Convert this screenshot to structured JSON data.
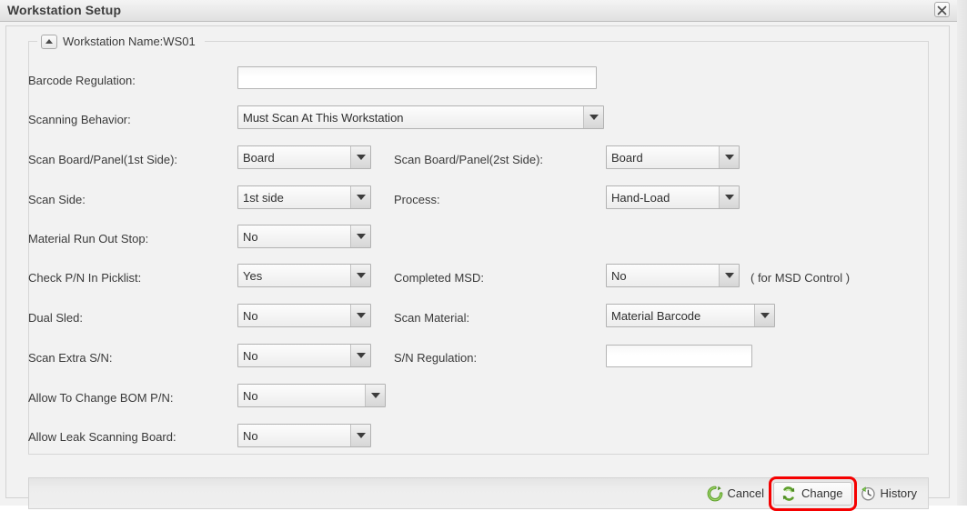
{
  "window": {
    "title": "Workstation Setup",
    "close_icon": "close-icon"
  },
  "group": {
    "legend": "Workstation Name:WS01",
    "collapse_icon": "collapse-up-icon"
  },
  "fields": {
    "barcode_regulation": {
      "label": "Barcode Regulation:",
      "value": "",
      "placeholder": ""
    },
    "scanning_behavior": {
      "label": "Scanning Behavior:",
      "value": "Must Scan At This Workstation"
    },
    "scan_board_panel_1st": {
      "label": "Scan Board/Panel(1st Side):",
      "value": "Board"
    },
    "scan_board_panel_2st": {
      "label": "Scan Board/Panel(2st Side):",
      "value": "Board"
    },
    "scan_side": {
      "label": "Scan Side:",
      "value": "1st side"
    },
    "process": {
      "label": "Process:",
      "value": "Hand-Load"
    },
    "material_run_out_stop": {
      "label": "Material Run Out Stop:",
      "value": "No"
    },
    "check_pn_in_picklist": {
      "label": "Check P/N In Picklist:",
      "value": "Yes"
    },
    "completed_msd": {
      "label": "Completed MSD:",
      "value": "No",
      "hint": "( for MSD Control )"
    },
    "dual_sled": {
      "label": "Dual Sled:",
      "value": "No"
    },
    "scan_material": {
      "label": "Scan Material:",
      "value": "Material Barcode"
    },
    "scan_extra_sn": {
      "label": "Scan Extra S/N:",
      "value": "No"
    },
    "sn_regulation": {
      "label": "S/N Regulation:",
      "value": "",
      "placeholder": ""
    },
    "allow_to_change_bom_pn": {
      "label": "Allow To Change BOM P/N:",
      "value": "No"
    },
    "allow_leak_scanning_board": {
      "label": "Allow Leak Scanning Board:",
      "value": "No"
    }
  },
  "footer": {
    "cancel": {
      "label": "Cancel",
      "icon": "revert-arrow-icon"
    },
    "change": {
      "label": "Change",
      "icon": "refresh-arrows-icon",
      "highlighted": true,
      "highlight_color": "#f50000"
    },
    "history": {
      "label": "History",
      "icon": "clock-back-icon"
    }
  }
}
